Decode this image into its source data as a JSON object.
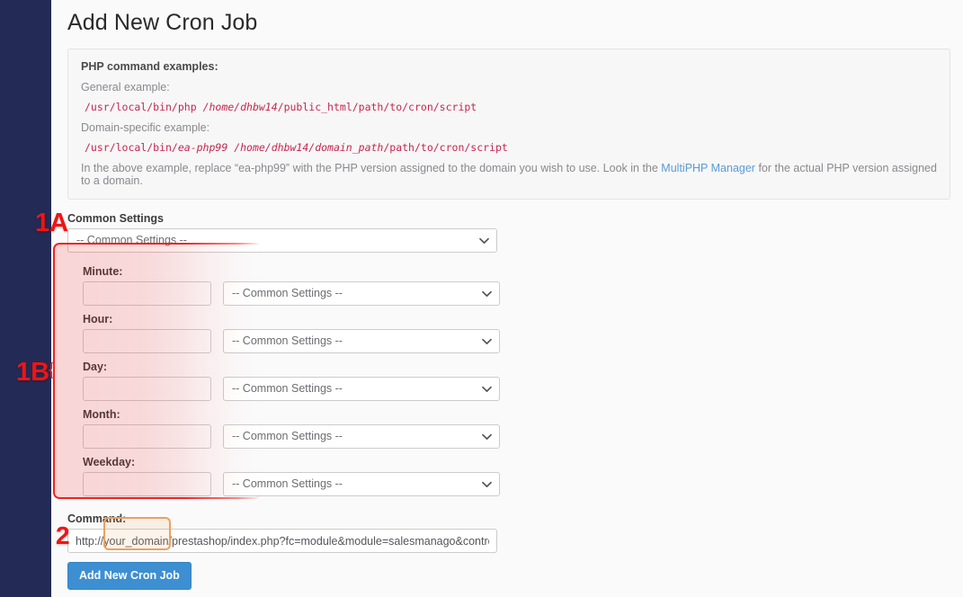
{
  "app": {
    "page_title": "Add New Cron Job",
    "sidebar_color": "#232a55",
    "accent_color": "#3d8fd1"
  },
  "info_panel": {
    "heading": "PHP command examples:",
    "general_label": "General example:",
    "general_code_prefix": "/usr/local/bin/php ",
    "general_code_em": "/home/dhbw14",
    "general_code_suffix": "/public_html/path/to/cron/script",
    "domain_label": "Domain-specific example:",
    "domain_code_prefix": "/usr/local/bin/",
    "domain_code_em1": "ea-php99",
    "domain_code_mid": " ",
    "domain_code_em2": "/home/dhbw14/domain_path",
    "domain_code_suffix": "/path/to/cron/script",
    "note_before": "In the above example, replace “ea-php99” with the PHP version assigned to the domain you wish to use. Look in the ",
    "note_link": "MultiPHP Manager",
    "note_after": " for the actual PHP version assigned to a domain."
  },
  "form": {
    "common_settings_label": "Common Settings",
    "common_settings_value": "-- Common Settings --",
    "schedule_fields": [
      {
        "label": "Minute:",
        "value": "",
        "select_value": "-- Common Settings --"
      },
      {
        "label": "Hour:",
        "value": "",
        "select_value": "-- Common Settings --"
      },
      {
        "label": "Day:",
        "value": "",
        "select_value": "-- Common Settings --"
      },
      {
        "label": "Month:",
        "value": "",
        "select_value": "-- Common Settings --"
      },
      {
        "label": "Weekday:",
        "value": "",
        "select_value": "-- Common Settings --"
      }
    ],
    "command_label": "Command:",
    "command_value": "http://your_domain/prestashop/index.php?fc=module&module=salesmanago&controller=cron",
    "submit_label": "Add New Cron Job"
  },
  "annotations": {
    "marker_1a": "1A",
    "marker_1b": "1B",
    "marker_2": "2",
    "brace": "{",
    "highlight_red": "#f42020",
    "highlight_orange": "#e9a25f",
    "marker_color": "#f01414"
  }
}
